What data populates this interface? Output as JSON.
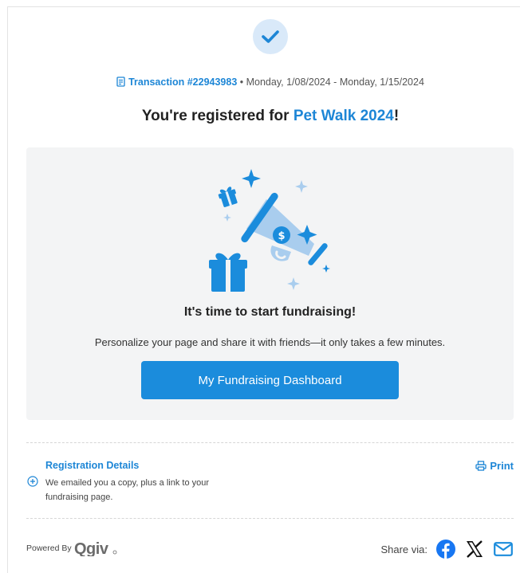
{
  "transaction": {
    "link_text": "Transaction #22943983",
    "dates": "• Monday, 1/08/2024 - Monday, 1/15/2024"
  },
  "title": {
    "prefix": "You're registered for ",
    "event": "Pet Walk 2024",
    "suffix": "!"
  },
  "fundraising": {
    "heading": "It's time to start fundraising!",
    "subtext": "Personalize your page and share it with friends—it only takes a few minutes.",
    "button": "My Fundraising Dashboard"
  },
  "registration": {
    "title": "Registration Details",
    "text_line1": "We emailed you a copy, plus a link to your",
    "text_line2": "fundraising page.",
    "print": "Print"
  },
  "footer": {
    "powered_by": "Powered By",
    "logo_text": "Qgiv",
    "share_label": "Share via:"
  },
  "colors": {
    "accent": "#1d86d6",
    "button": "#1b8cdc",
    "panel": "#f3f4f5",
    "check_bg": "#d9e9f9"
  },
  "icons": [
    "check-icon",
    "receipt-icon",
    "megaphone-illustration",
    "plus-circle-icon",
    "print-icon",
    "facebook-icon",
    "x-icon",
    "email-icon"
  ]
}
